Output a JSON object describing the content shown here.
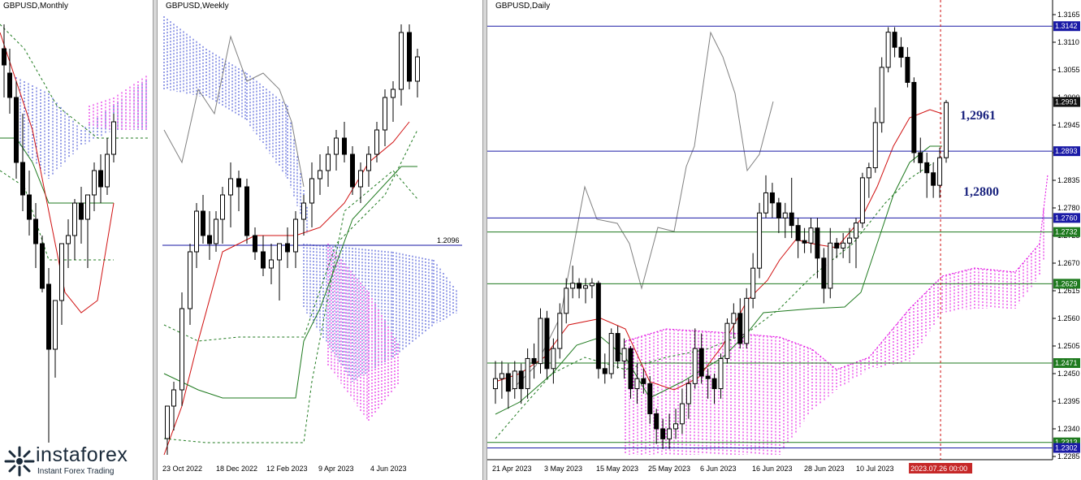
{
  "panels": {
    "monthly": {
      "title": "GBPUSD,Monthly"
    },
    "weekly": {
      "title": "GBPUSD,Weekly",
      "level_label": "1.2096",
      "x_ticks": [
        "23 Oct 2022",
        "18 Dec 2022",
        "12 Feb 2023",
        "9 Apr 2023",
        "4 Jun 2023"
      ]
    },
    "daily": {
      "title": "GBPUSD,Daily",
      "y_ticks": [
        "1.3165",
        "1.3110",
        "1.3055",
        "1.3000",
        "1.2945",
        "1.2890",
        "1.2835",
        "1.2780",
        "1.2725",
        "1.2670",
        "1.2615",
        "1.2560",
        "1.2505",
        "1.2450",
        "1.2395",
        "1.2340",
        "1.2285"
      ],
      "x_ticks": [
        "21 Apr 2023",
        "3 May 2023",
        "15 May 2023",
        "25 May 2023",
        "6 Jun 2023",
        "16 Jun 2023",
        "28 Jun 2023",
        "10 Jul 2023"
      ],
      "crosshair_time": "2023.07.26 00:00",
      "annotations": [
        "1,2961",
        "1,2800"
      ],
      "level_tags": [
        {
          "label": "1.3142",
          "color": "#1a1aa6"
        },
        {
          "label": "1.2991",
          "color": "#111111"
        },
        {
          "label": "1.2893",
          "color": "#1a1aa6"
        },
        {
          "label": "1.2760",
          "color": "#1a1aa6"
        },
        {
          "label": "1.2732",
          "color": "#1f7a1f"
        },
        {
          "label": "1.2629",
          "color": "#1f7a1f"
        },
        {
          "label": "1.2471",
          "color": "#1f7a1f"
        },
        {
          "label": "1.2313",
          "color": "#1f7a1f"
        },
        {
          "label": "1.2302",
          "color": "#1a1aa6"
        }
      ]
    }
  },
  "logo": {
    "name": "instaforex",
    "tagline": "Instant Forex Trading"
  },
  "chart_data": {
    "type": "candlestick",
    "title": "GBPUSD,Daily",
    "ylim": [
      1.2285,
      1.3165
    ],
    "horizontal_levels": [
      1.3142,
      1.2991,
      1.2893,
      1.276,
      1.2732,
      1.2629,
      1.2471,
      1.2313,
      1.2302
    ],
    "annotations": [
      "1,2961",
      "1,2800"
    ],
    "candles": [
      {
        "d": "2023-04-19",
        "o": 1.242,
        "h": 1.2475,
        "l": 1.239,
        "c": 1.244
      },
      {
        "d": "2023-04-20",
        "o": 1.244,
        "h": 1.2475,
        "l": 1.24,
        "c": 1.245
      },
      {
        "d": "2023-04-21",
        "o": 1.245,
        "h": 1.247,
        "l": 1.238,
        "c": 1.2415
      },
      {
        "d": "2023-04-24",
        "o": 1.242,
        "h": 1.2475,
        "l": 1.24,
        "c": 1.2455
      },
      {
        "d": "2023-04-25",
        "o": 1.2455,
        "h": 1.247,
        "l": 1.239,
        "c": 1.242
      },
      {
        "d": "2023-04-26",
        "o": 1.242,
        "h": 1.25,
        "l": 1.24,
        "c": 1.248
      },
      {
        "d": "2023-04-27",
        "o": 1.248,
        "h": 1.251,
        "l": 1.244,
        "c": 1.247
      },
      {
        "d": "2023-04-28",
        "o": 1.247,
        "h": 1.258,
        "l": 1.245,
        "c": 1.256
      },
      {
        "d": "2023-05-01",
        "o": 1.256,
        "h": 1.2575,
        "l": 1.244,
        "c": 1.246
      },
      {
        "d": "2023-05-02",
        "o": 1.246,
        "h": 1.252,
        "l": 1.243,
        "c": 1.25
      },
      {
        "d": "2023-05-03",
        "o": 1.25,
        "h": 1.259,
        "l": 1.248,
        "c": 1.257
      },
      {
        "d": "2023-05-04",
        "o": 1.257,
        "h": 1.264,
        "l": 1.255,
        "c": 1.262
      },
      {
        "d": "2023-05-05",
        "o": 1.262,
        "h": 1.2665,
        "l": 1.26,
        "c": 1.263
      },
      {
        "d": "2023-05-08",
        "o": 1.263,
        "h": 1.264,
        "l": 1.26,
        "c": 1.262
      },
      {
        "d": "2023-05-09",
        "o": 1.262,
        "h": 1.264,
        "l": 1.259,
        "c": 1.2625
      },
      {
        "d": "2023-05-10",
        "o": 1.2625,
        "h": 1.264,
        "l": 1.26,
        "c": 1.263
      },
      {
        "d": "2023-05-11",
        "o": 1.263,
        "h": 1.2635,
        "l": 1.244,
        "c": 1.246
      },
      {
        "d": "2023-05-12",
        "o": 1.246,
        "h": 1.249,
        "l": 1.243,
        "c": 1.245
      },
      {
        "d": "2023-05-15",
        "o": 1.245,
        "h": 1.254,
        "l": 1.244,
        "c": 1.253
      },
      {
        "d": "2023-05-16",
        "o": 1.253,
        "h": 1.2545,
        "l": 1.246,
        "c": 1.2475
      },
      {
        "d": "2023-05-17",
        "o": 1.2475,
        "h": 1.252,
        "l": 1.244,
        "c": 1.25
      },
      {
        "d": "2023-05-18",
        "o": 1.25,
        "h": 1.2505,
        "l": 1.24,
        "c": 1.242
      },
      {
        "d": "2023-05-19",
        "o": 1.242,
        "h": 1.247,
        "l": 1.239,
        "c": 1.244
      },
      {
        "d": "2023-05-22",
        "o": 1.244,
        "h": 1.246,
        "l": 1.241,
        "c": 1.243
      },
      {
        "d": "2023-05-23",
        "o": 1.243,
        "h": 1.2445,
        "l": 1.235,
        "c": 1.237
      },
      {
        "d": "2023-05-24",
        "o": 1.237,
        "h": 1.238,
        "l": 1.231,
        "c": 1.234
      },
      {
        "d": "2023-05-25",
        "o": 1.234,
        "h": 1.236,
        "l": 1.23,
        "c": 1.232
      },
      {
        "d": "2023-05-26",
        "o": 1.232,
        "h": 1.237,
        "l": 1.23,
        "c": 1.234
      },
      {
        "d": "2023-05-29",
        "o": 1.234,
        "h": 1.238,
        "l": 1.232,
        "c": 1.235
      },
      {
        "d": "2023-05-30",
        "o": 1.235,
        "h": 1.242,
        "l": 1.233,
        "c": 1.239
      },
      {
        "d": "2023-05-31",
        "o": 1.239,
        "h": 1.244,
        "l": 1.236,
        "c": 1.243
      },
      {
        "d": "2023-06-01",
        "o": 1.243,
        "h": 1.254,
        "l": 1.242,
        "c": 1.25
      },
      {
        "d": "2023-06-02",
        "o": 1.25,
        "h": 1.253,
        "l": 1.243,
        "c": 1.2445
      },
      {
        "d": "2023-06-05",
        "o": 1.2445,
        "h": 1.246,
        "l": 1.24,
        "c": 1.244
      },
      {
        "d": "2023-06-06",
        "o": 1.244,
        "h": 1.245,
        "l": 1.239,
        "c": 1.242
      },
      {
        "d": "2023-06-07",
        "o": 1.242,
        "h": 1.249,
        "l": 1.24,
        "c": 1.248
      },
      {
        "d": "2023-06-08",
        "o": 1.248,
        "h": 1.256,
        "l": 1.247,
        "c": 1.255
      },
      {
        "d": "2023-06-09",
        "o": 1.255,
        "h": 1.259,
        "l": 1.252,
        "c": 1.257
      },
      {
        "d": "2023-06-12",
        "o": 1.257,
        "h": 1.26,
        "l": 1.25,
        "c": 1.251
      },
      {
        "d": "2023-06-13",
        "o": 1.251,
        "h": 1.262,
        "l": 1.25,
        "c": 1.26
      },
      {
        "d": "2023-06-14",
        "o": 1.26,
        "h": 1.269,
        "l": 1.258,
        "c": 1.266
      },
      {
        "d": "2023-06-15",
        "o": 1.266,
        "h": 1.279,
        "l": 1.264,
        "c": 1.277
      },
      {
        "d": "2023-06-16",
        "o": 1.277,
        "h": 1.2845,
        "l": 1.276,
        "c": 1.281
      },
      {
        "d": "2023-06-19",
        "o": 1.281,
        "h": 1.283,
        "l": 1.276,
        "c": 1.279
      },
      {
        "d": "2023-06-20",
        "o": 1.279,
        "h": 1.28,
        "l": 1.273,
        "c": 1.276
      },
      {
        "d": "2023-06-21",
        "o": 1.276,
        "h": 1.279,
        "l": 1.272,
        "c": 1.277
      },
      {
        "d": "2023-06-22",
        "o": 1.277,
        "h": 1.284,
        "l": 1.272,
        "c": 1.2745
      },
      {
        "d": "2023-06-23",
        "o": 1.2745,
        "h": 1.276,
        "l": 1.268,
        "c": 1.2715
      },
      {
        "d": "2023-06-26",
        "o": 1.2715,
        "h": 1.274,
        "l": 1.269,
        "c": 1.271
      },
      {
        "d": "2023-06-27",
        "o": 1.271,
        "h": 1.276,
        "l": 1.269,
        "c": 1.274
      },
      {
        "d": "2023-06-28",
        "o": 1.274,
        "h": 1.276,
        "l": 1.264,
        "c": 1.268
      },
      {
        "d": "2023-06-29",
        "o": 1.268,
        "h": 1.27,
        "l": 1.259,
        "c": 1.262
      },
      {
        "d": "2023-06-30",
        "o": 1.262,
        "h": 1.274,
        "l": 1.26,
        "c": 1.271
      },
      {
        "d": "2023-07-03",
        "o": 1.271,
        "h": 1.272,
        "l": 1.268,
        "c": 1.27
      },
      {
        "d": "2023-07-04",
        "o": 1.27,
        "h": 1.273,
        "l": 1.268,
        "c": 1.271
      },
      {
        "d": "2023-07-05",
        "o": 1.271,
        "h": 1.274,
        "l": 1.267,
        "c": 1.272
      },
      {
        "d": "2023-07-06",
        "o": 1.272,
        "h": 1.276,
        "l": 1.266,
        "c": 1.275
      },
      {
        "d": "2023-07-07",
        "o": 1.275,
        "h": 1.285,
        "l": 1.274,
        "c": 1.284
      },
      {
        "d": "2023-07-10",
        "o": 1.284,
        "h": 1.287,
        "l": 1.28,
        "c": 1.286
      },
      {
        "d": "2023-07-11",
        "o": 1.286,
        "h": 1.298,
        "l": 1.285,
        "c": 1.295
      },
      {
        "d": "2023-07-12",
        "o": 1.295,
        "h": 1.308,
        "l": 1.293,
        "c": 1.306
      },
      {
        "d": "2023-07-13",
        "o": 1.306,
        "h": 1.314,
        "l": 1.305,
        "c": 1.313
      },
      {
        "d": "2023-07-14",
        "o": 1.313,
        "h": 1.314,
        "l": 1.308,
        "c": 1.31
      },
      {
        "d": "2023-07-17",
        "o": 1.31,
        "h": 1.312,
        "l": 1.306,
        "c": 1.308
      },
      {
        "d": "2023-07-18",
        "o": 1.308,
        "h": 1.31,
        "l": 1.302,
        "c": 1.303
      },
      {
        "d": "2023-07-19",
        "o": 1.303,
        "h": 1.304,
        "l": 1.287,
        "c": 1.289
      },
      {
        "d": "2023-07-20",
        "o": 1.289,
        "h": 1.292,
        "l": 1.285,
        "c": 1.287
      },
      {
        "d": "2023-07-21",
        "o": 1.287,
        "h": 1.289,
        "l": 1.28,
        "c": 1.285
      },
      {
        "d": "2023-07-24",
        "o": 1.285,
        "h": 1.287,
        "l": 1.28,
        "c": 1.2825
      },
      {
        "d": "2023-07-25",
        "o": 1.2825,
        "h": 1.29,
        "l": 1.28,
        "c": 1.288
      },
      {
        "d": "2023-07-26",
        "o": 1.288,
        "h": 1.2995,
        "l": 1.287,
        "c": 1.299
      }
    ]
  }
}
